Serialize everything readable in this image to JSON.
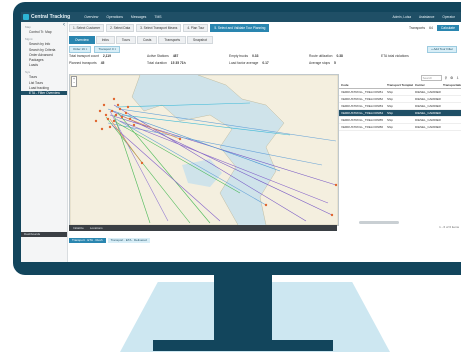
{
  "app": {
    "title": "Central Tracking"
  },
  "topnav": [
    "Overview",
    "Operations",
    "Messages",
    "TMS"
  ],
  "topright": [
    "Admin, Luisa",
    "Assistance",
    "Operator"
  ],
  "sidebar": {
    "groups": [
      {
        "label": "Map",
        "items": [
          "Control Tr. Map"
        ]
      },
      {
        "label": "Mgmt",
        "items": [
          "Search by Info",
          "Search by Criteria",
          "Order Advanced",
          "Packages",
          "Loads"
        ]
      },
      {
        "label": "Sys",
        "items": [
          "Tours",
          "List Tours",
          "Load tracking"
        ]
      }
    ],
    "selected": "ETA - Filter Overview"
  },
  "steps": [
    "1. Select Customer",
    "2. Select Data",
    "3. Select Transport Means",
    "4. Plan Tour",
    "5. Select and Validate Tour Planning"
  ],
  "step_right": {
    "label": "Transports",
    "count": "64",
    "button": "Calculate"
  },
  "tabs": [
    "Overview",
    "Infos",
    "Tours",
    "Costs",
    "Transports",
    "Snapshot"
  ],
  "chips": [
    "Order 19 ×",
    "Transport 0 ×"
  ],
  "add_button": "+ Add Tour Filter",
  "stats": [
    {
      "label": "Total transport count",
      "value": "2,119"
    },
    {
      "label": "Planned transports",
      "value": "45"
    },
    {
      "label": "Active Stations",
      "value": "487"
    },
    {
      "label": "Total duration",
      "value": "15 35 71h"
    },
    {
      "label": "Empty trucks",
      "value": "0.33"
    },
    {
      "label": "Load factor average",
      "value": "0.17"
    },
    {
      "label": "Route utilization",
      "value": "0.38"
    },
    {
      "label": "Average stops",
      "value": "5"
    },
    {
      "label": "ETA total violations",
      "value": ""
    }
  ],
  "map_footer": [
    "Initialize",
    "Locations"
  ],
  "table": {
    "search_placeholder": "Search",
    "columns": [
      "Code",
      "Transport Template",
      "Carrier",
      "Transportation"
    ],
    "rows": [
      [
        "VERDUSTROLL_TRELOONB1",
        "Ship",
        "DIESEL_CARRIER",
        ""
      ],
      [
        "VERDUSTROLL_TRELOONB2",
        "Ship",
        "DIESEL_CARRIER",
        ""
      ],
      [
        "VERDUSTROLL_TRELOONB3",
        "Ship",
        "DIESEL_CARRIER",
        ""
      ],
      [
        "VERDUSTROLL_TRELOONB4",
        "Ship",
        "DIESEL_CARRIER",
        ""
      ],
      [
        "VERDUSTROLL_TRELOONB5",
        "Ship",
        "DIESEL_CARRIER",
        ""
      ],
      [
        "VERDUSTROLL_TRELOONB6",
        "Ship",
        "DIESEL_CARRIER",
        ""
      ]
    ],
    "selected_row": 3,
    "count": "1 - 6 of 6 items"
  },
  "bottom": {
    "left_label": "Dashboards",
    "chips": [
      "Transport · ETA · Rush",
      "Transport · ETA · Delivered"
    ]
  },
  "colors": {
    "brand": "#1f4f66",
    "accent": "#2a86b0",
    "bezel": "#12455c"
  }
}
